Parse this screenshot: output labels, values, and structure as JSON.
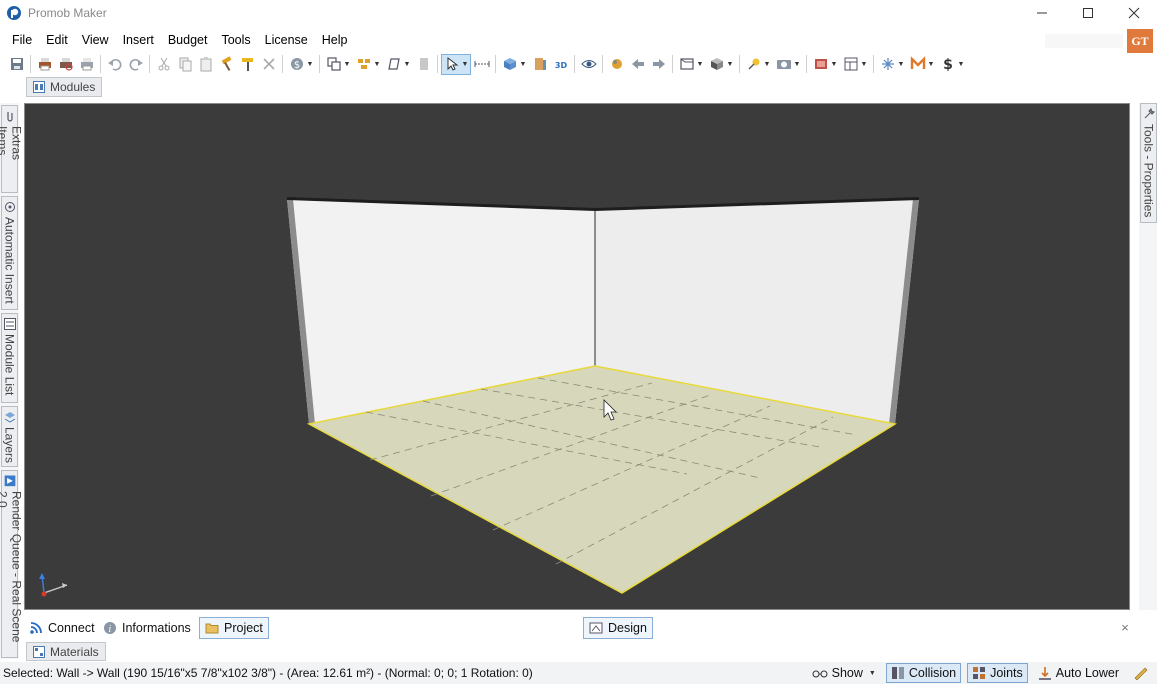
{
  "window": {
    "title": "Promob Maker",
    "minimize_label": "—",
    "maximize_label": "☐",
    "close_label": "✕"
  },
  "menu": {
    "items": [
      "File",
      "Edit",
      "View",
      "Insert",
      "Budget",
      "Tools",
      "License",
      "Help"
    ],
    "user_initials": "GT"
  },
  "toolbar": {
    "icons": [
      "save-icon",
      "print-icon",
      "print-preview-icon",
      "printer-icon",
      "undo-icon",
      "redo-icon",
      "cut-icon",
      "copy-icon",
      "paste-icon",
      "hammer-icon",
      "paint-roller-icon",
      "delete-icon",
      "money-icon",
      "clone-icon",
      "align-icon",
      "shape-icon",
      "panel-icon",
      "select-arrow-icon",
      "measure-icon",
      "layers-cube-icon",
      "door-icon",
      "view-3d-icon",
      "eye-icon",
      "orbit-icon",
      "previous-view-icon",
      "next-view-icon",
      "perspective-icon",
      "box-icon",
      "light-icon",
      "camera-icon",
      "render-icon",
      "table-icon",
      "snowflake-icon",
      "mm-icon",
      "dollar-icon"
    ]
  },
  "panels": {
    "modules_tab": "Modules",
    "materials_tab": "Materials",
    "left_tabs": [
      "Extras Items",
      "Automatic Insert",
      "Module List",
      "Layers",
      "Render Queue - Real Scene 2.0"
    ],
    "right_tabs": [
      "Tools - Properties"
    ]
  },
  "bottom_tabs": {
    "connect": "Connect",
    "informations": "Informations",
    "project": "Project",
    "design": "Design",
    "close": "×"
  },
  "status": {
    "selection": "Selected: Wall -> Wall (190 15/16\"x5 7/8\"x102 3/8\") - (Area: 12.61 m²) - (Normal: 0; 0; 1 Rotation: 0)",
    "show_label": "Show",
    "collision_label": "Collision",
    "joints_label": "Joints",
    "auto_lower_label": "Auto Lower"
  },
  "colors": {
    "viewport_bg": "#3b3b3b",
    "floor": "#d8d8bb",
    "wall": "#f4f4f4",
    "selection_outline": "#e8d93a",
    "accent": "#e07a3c"
  }
}
